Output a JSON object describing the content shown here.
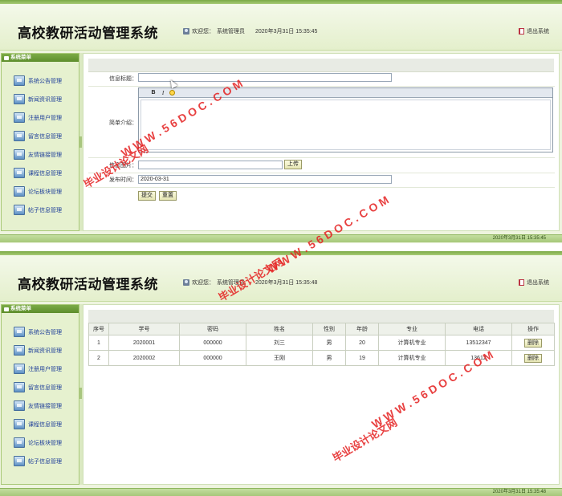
{
  "app_title": "高校教研活动管理系统",
  "screen1": {
    "header": {
      "welcome_prefix": "欢迎您：",
      "user": "系统管理员",
      "datetime": "2020年3月31日 15:35:45",
      "logout": "退出系统"
    },
    "footer": "2020年3月31日  15:35:45",
    "form": {
      "title_label": "信息标题：",
      "title_value": "",
      "intro_label": "简单介绍：",
      "image_label": "信息图片：",
      "upload_button": "上传",
      "date_label": "发布时间：",
      "date_value": "2020-03-31",
      "submit_button": "提交",
      "reset_button": "重置"
    },
    "editor_toolbar": {
      "bold": "B",
      "italic": "I"
    }
  },
  "screen2": {
    "header": {
      "welcome_prefix": "欢迎您：",
      "user": "系统管理员",
      "datetime": "2020年3月31日 15:35:48",
      "logout": "退出系统"
    },
    "footer": "2020年3月31日  15:35:48",
    "table": {
      "headers": [
        "序号",
        "学号",
        "密码",
        "姓名",
        "性别",
        "年龄",
        "专业",
        "电话",
        "操作"
      ],
      "rows": [
        [
          "1",
          "2020001",
          "000000",
          "刘三",
          "男",
          "20",
          "计算机专业",
          "13512347",
          "删除"
        ],
        [
          "2",
          "2020002",
          "000000",
          "王刚",
          "男",
          "19",
          "计算机专业",
          "13612",
          "删除"
        ]
      ]
    }
  },
  "sidebar": {
    "title": "系统菜单",
    "items": [
      "系统公告管理",
      "新闻资讯管理",
      "注册用户管理",
      "留言信息管理",
      "友情链接管理",
      "课程信息管理",
      "论坛板块管理",
      "帖子信息管理"
    ]
  },
  "watermarks": {
    "site": "W W W . 5 6 D O C . C O M",
    "name": "毕业设计论文网"
  },
  "colors": {
    "accent_green": "#7cab47",
    "watermark_red": "#e52020",
    "link_blue": "#1f3f9a"
  }
}
